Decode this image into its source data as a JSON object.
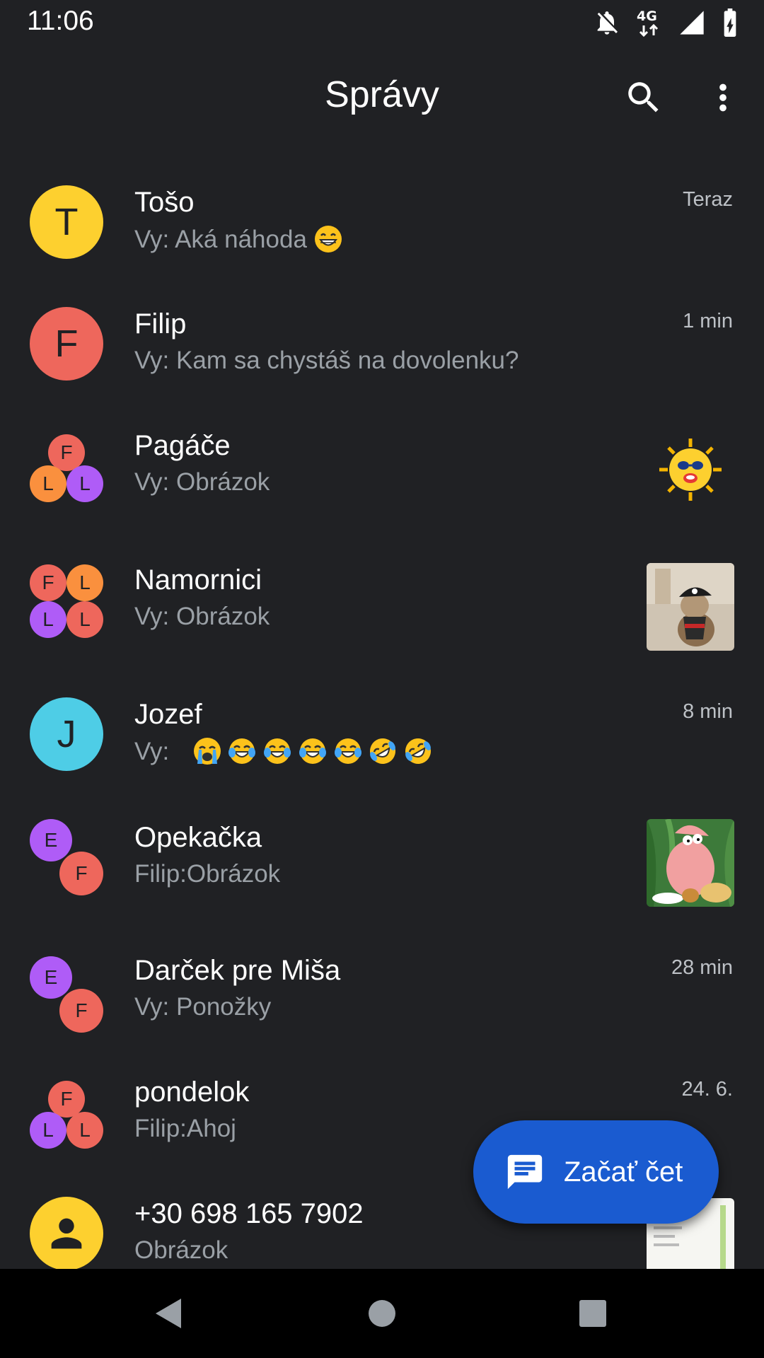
{
  "status_bar": {
    "time": "11:06",
    "network": "4G"
  },
  "app_bar": {
    "title": "Správy"
  },
  "conversations": [
    {
      "name": "Tošo",
      "sender": "Vy:",
      "snippet": "Aká náhoda",
      "time": "Teraz",
      "avatar_letters": [
        "T"
      ],
      "avatar_colors": [
        "#fdd02f"
      ]
    },
    {
      "name": "Filip",
      "sender": "Vy:",
      "snippet": "Kam sa chystáš na dovolenku?",
      "time": "1 min",
      "avatar_letters": [
        "F"
      ],
      "avatar_colors": [
        "#ee675c"
      ]
    },
    {
      "name": "Pagáče",
      "sender": "Vy:",
      "snippet": "Obrázok",
      "avatar_letters": [
        "F",
        "L",
        "L"
      ],
      "avatar_colors": [
        "#ee675c",
        "#fa903e",
        "#af5cf7"
      ],
      "thumbnail": "sun-sticker"
    },
    {
      "name": "Namornici",
      "sender": "Vy:",
      "snippet": "Obrázok",
      "avatar_letters": [
        "F",
        "L",
        "L",
        "L"
      ],
      "avatar_colors": [
        "#ee675c",
        "#fa903e",
        "#af5cf7",
        "#ee675c"
      ],
      "thumbnail": "pirate-cat-photo"
    },
    {
      "name": "Jozef",
      "sender": "Vy:",
      "snippet": "",
      "time": "8 min",
      "avatar_letters": [
        "J"
      ],
      "avatar_colors": [
        "#4ecde6"
      ],
      "emojis": [
        "crying-face",
        "tears-of-joy",
        "tears-of-joy",
        "tears-of-joy",
        "tears-of-joy",
        "rofl",
        "rofl"
      ]
    },
    {
      "name": "Opekačka",
      "sender": "Filip:",
      "snippet": "Obrázok",
      "avatar_letters": [
        "E",
        "F"
      ],
      "avatar_colors": [
        "#af5cf7",
        "#ee675c"
      ],
      "thumbnail": "patrick-photo"
    },
    {
      "name": "Darček pre Miša",
      "sender": "Vy:",
      "snippet": "Ponožky",
      "time": "28 min",
      "avatar_letters": [
        "E",
        "F"
      ],
      "avatar_colors": [
        "#af5cf7",
        "#ee675c"
      ]
    },
    {
      "name": "pondelok",
      "sender": "Filip:",
      "snippet": "Ahoj",
      "time": "24. 6.",
      "avatar_letters": [
        "F",
        "L",
        "L"
      ],
      "avatar_colors": [
        "#ee675c",
        "#af5cf7",
        "#ee675c"
      ]
    },
    {
      "name": "+30 698 165 7902",
      "sender": "",
      "snippet": "Obrázok",
      "avatar_icon": "person-icon",
      "avatar_colors": [
        "#fdd02f"
      ],
      "thumbnail": "document-photo"
    }
  ],
  "fab": {
    "label": "Začať čet"
  },
  "colors": {
    "background": "#202124",
    "fab": "#1a5bd0",
    "nav": "#000000"
  }
}
